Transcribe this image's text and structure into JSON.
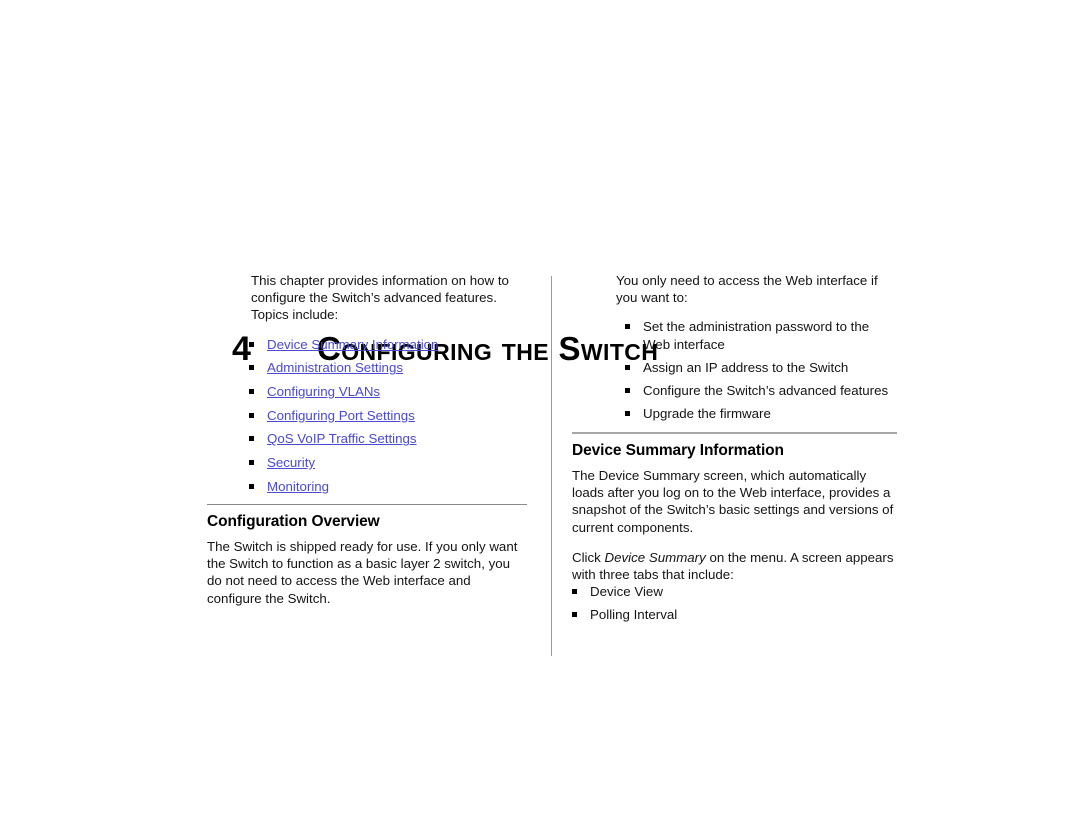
{
  "chapter": {
    "number": "4",
    "title": "Configuring the Switch"
  },
  "left_column": {
    "intro_paragraph": "This chapter provides information on how to configure the Switch’s advanced features. Topics include:",
    "topic_links": [
      "Device Summary Information",
      "Administration Settings",
      "Configuring VLANs",
      "Configuring Port Settings",
      "QoS VoIP Traffic Settings",
      "Security",
      "Monitoring"
    ],
    "section": {
      "heading": "Configuration Overview",
      "paragraph": "The Switch is shipped ready for use. If you only want the Switch to function as a basic layer 2 switch, you do not need to access the Web interface and configure the Switch."
    }
  },
  "right_column": {
    "intro_paragraph": "You only need to access the Web interface if you want to:",
    "intro_bullets": [
      "Set the administration password to the Web interface",
      "Assign an IP address to the Switch",
      "Configure the Switch’s advanced features",
      "Upgrade the firmware"
    ],
    "section": {
      "heading": "Device Summary Information",
      "paragraph_1": "The Device Summary screen, which automatically loads after you log on to the Web interface, provides a snapshot of the Switch’s basic settings and versions of current components.",
      "paragraph_2_prefix": "Click ",
      "paragraph_2_italic": "Device Summary",
      "paragraph_2_suffix": " on the menu. A screen appears with three tabs that include:",
      "tabs": [
        "Device View",
        "Polling Interval"
      ]
    }
  },
  "colors": {
    "link": "#4a4ad2",
    "rule": "#8a8a8a",
    "divider": "#9a9a9a",
    "text": "#141414"
  }
}
